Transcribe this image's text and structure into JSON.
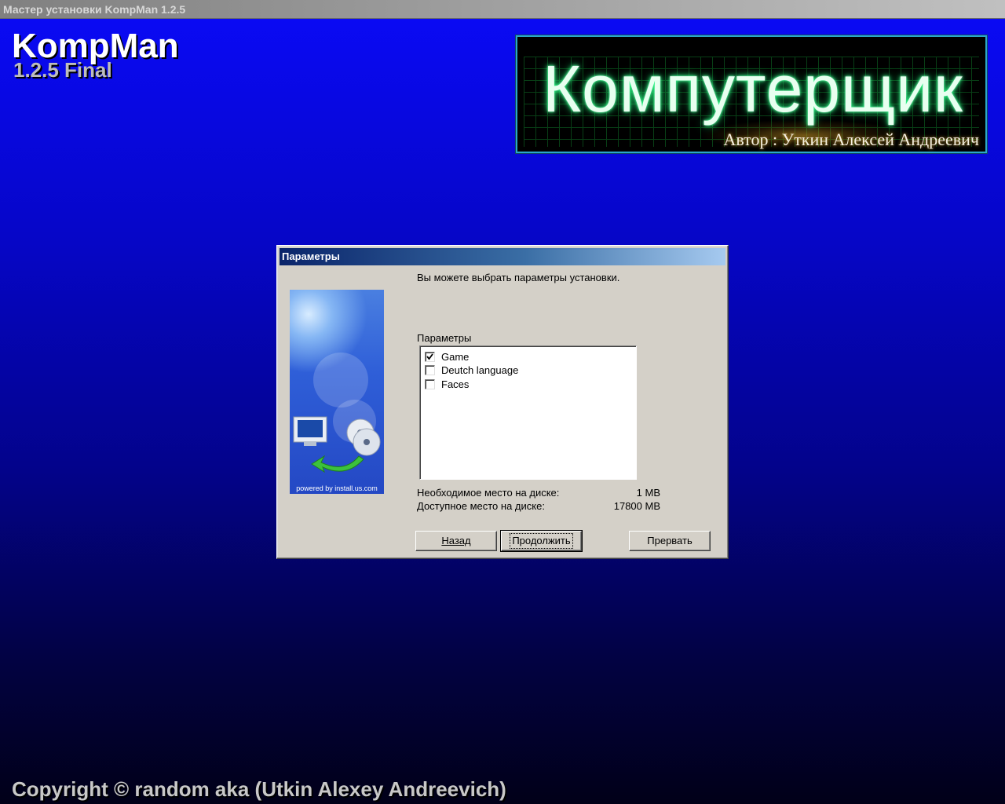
{
  "window": {
    "title": "Мастер установки KompMan 1.2.5"
  },
  "header": {
    "app_name": "KompMan",
    "version": "1.2.5 Final"
  },
  "logo": {
    "title": "Компутерщик",
    "author": "Автор : Уткин Алексей Андреевич"
  },
  "dialog": {
    "title": "Параметры",
    "instruction": "Вы можете выбрать параметры установки.",
    "group_label": "Параметры",
    "sidebar_caption": "powered by install.us.com",
    "options": [
      {
        "label": "Game",
        "checked": true
      },
      {
        "label": "Deutch language",
        "checked": false
      },
      {
        "label": "Faces",
        "checked": false
      }
    ],
    "disk": {
      "required_label": "Необходимое место на диске:",
      "required_value": "1 MB",
      "available_label": "Доступное место на диске:",
      "available_value": "17800 MB"
    },
    "buttons": {
      "back": "Назад",
      "next": "Продолжить",
      "cancel": "Прервать"
    }
  },
  "footer": {
    "copyright": "Copyright © random aka (Utkin Alexey Andreevich)"
  },
  "colors": {
    "background_top": "#0a0af7",
    "background_bottom": "#010018",
    "dialog_face": "#d4d0c8",
    "dialog_title_start": "#0a246a",
    "dialog_title_end": "#a6caf0",
    "logo_glow": "#2bff8a"
  },
  "icons": {
    "checkbox_checked": "checkmark-icon",
    "sidebar_illustration": "computer-cd-install-icon"
  }
}
